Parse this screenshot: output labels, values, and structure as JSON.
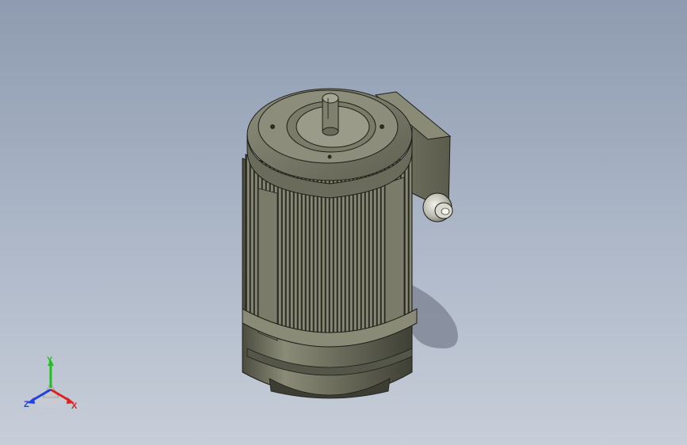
{
  "viewport": {
    "background_top": "#8e9bb0",
    "background_bottom": "#c7ced9"
  },
  "model": {
    "name": "motor-model",
    "body_color": "#6f7060",
    "fin_color": "#5a5b4c",
    "highlight_color": "#9a9b88",
    "edge_color": "#1e1e18"
  },
  "triad": {
    "x_label": "X",
    "y_label": "Y",
    "z_label": "Z",
    "x_color": "#e02020",
    "y_color": "#20c020",
    "z_color": "#2040e0"
  }
}
